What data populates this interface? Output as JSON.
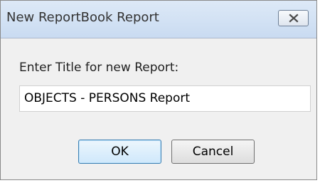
{
  "window": {
    "title": "New ReportBook Report",
    "close_icon": "close-icon"
  },
  "form": {
    "prompt_label": "Enter Title for new Report:",
    "title_value": "OBJECTS - PERSONS Report"
  },
  "buttons": {
    "ok_label": "OK",
    "cancel_label": "Cancel"
  },
  "colors": {
    "titlebar": "#c9dbf1",
    "dialog_background": "#f0f0f0",
    "default_button_border": "#3c7fb1"
  }
}
